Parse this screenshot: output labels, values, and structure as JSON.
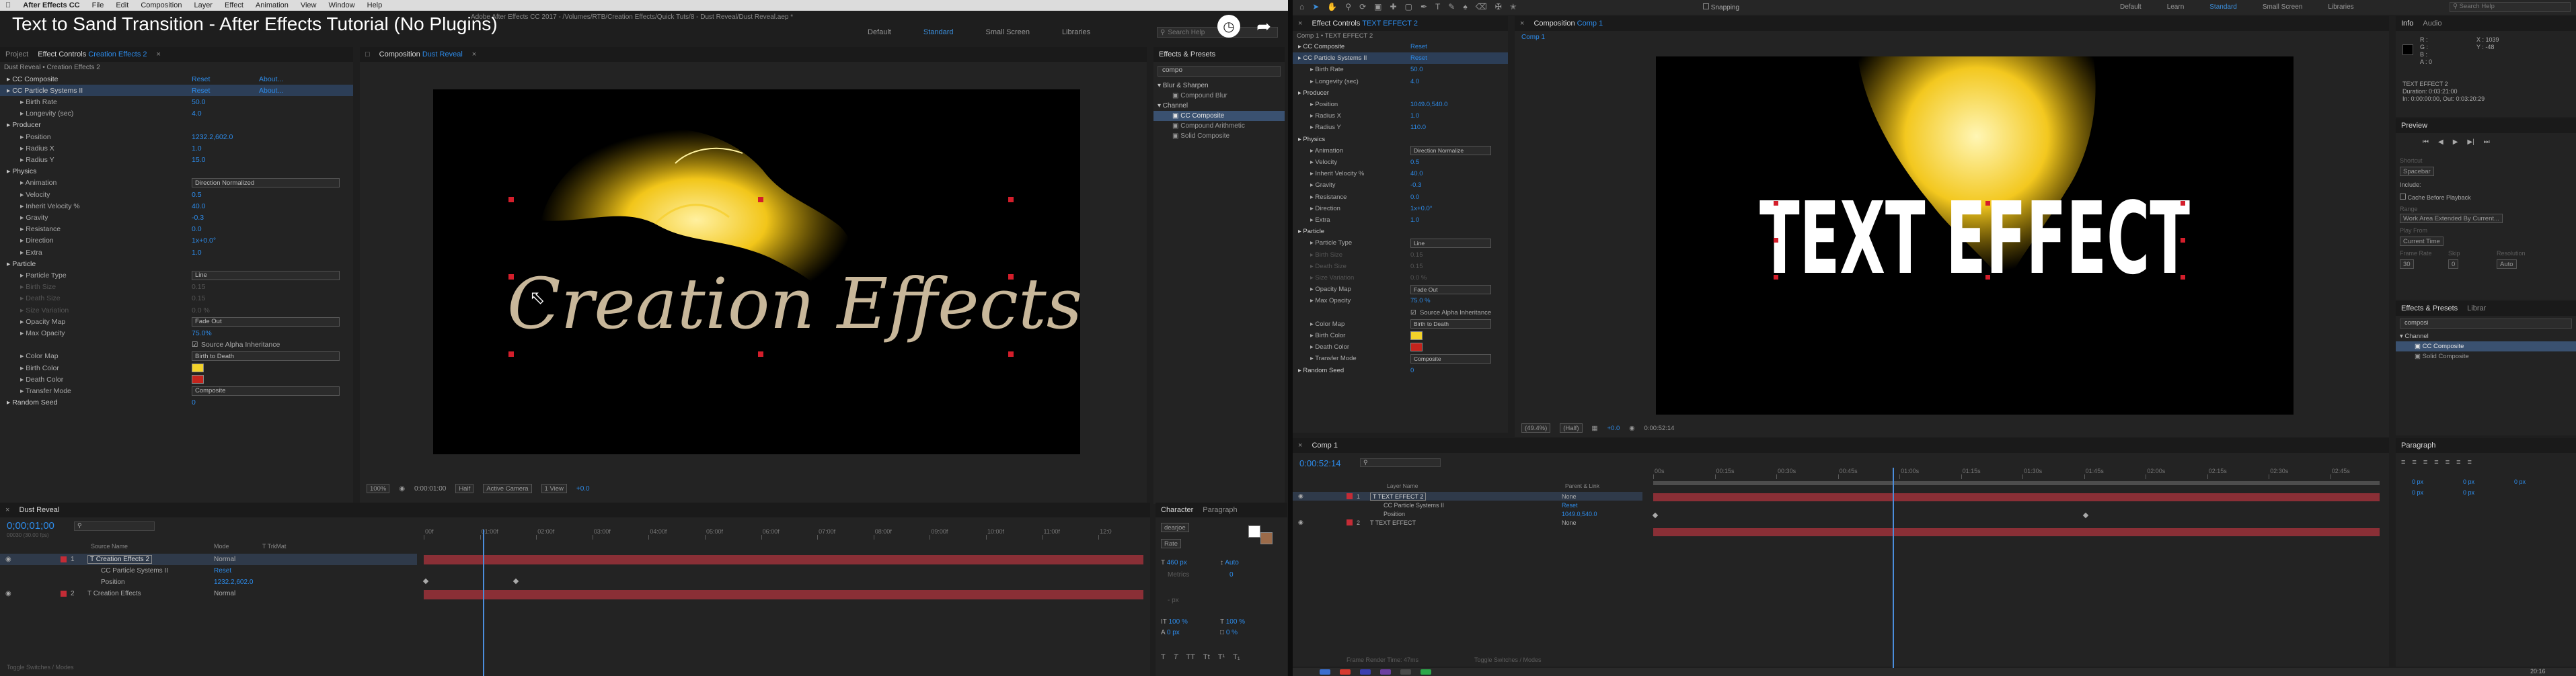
{
  "video": {
    "title": "Text to Sand Transition - After Effects Tutorial (No Plugins)"
  },
  "left_app": {
    "app_name": "After Effects CC",
    "menu": [
      "File",
      "Edit",
      "Composition",
      "Layer",
      "Effect",
      "Animation",
      "View",
      "Window",
      "Help"
    ],
    "title_path": "Adobe After Effects CC 2017 - /Volumes/RTB/Creation Effects/Quick Tuts/8 - Dust Reveal/Dust Reveal.aep *",
    "workspaces": [
      "Default",
      "Standard",
      "Small Screen",
      "Libraries"
    ],
    "search_placeholder": "Search Help",
    "project_tab": "Project",
    "effect_controls_tab": "Effect Controls",
    "effect_controls_layer": "Creation Effects 2",
    "breadcrumb": "Dust Reveal • Creation Effects 2",
    "effects": [
      {
        "name": "CC Composite",
        "value": "Reset",
        "extra": "About..."
      },
      {
        "name": "CC Particle Systems II",
        "value": "Reset",
        "extra": "About..."
      },
      {
        "name": "Birth Rate",
        "value": "50.0"
      },
      {
        "name": "Longevity (sec)",
        "value": "4.0"
      },
      {
        "name": "Producer",
        "value": ""
      },
      {
        "name": "Position",
        "value": "1232.2,602.0"
      },
      {
        "name": "Radius X",
        "value": "1.0"
      },
      {
        "name": "Radius Y",
        "value": "15.0"
      },
      {
        "name": "Physics",
        "value": ""
      },
      {
        "name": "Animation",
        "value": "Direction Normalized"
      },
      {
        "name": "Velocity",
        "value": "0.5"
      },
      {
        "name": "Inherit Velocity %",
        "value": "40.0"
      },
      {
        "name": "Gravity",
        "value": "-0.3"
      },
      {
        "name": "Resistance",
        "value": "0.0"
      },
      {
        "name": "Direction",
        "value": "1x+0.0°"
      },
      {
        "name": "Extra",
        "value": "1.0"
      },
      {
        "name": "Particle",
        "value": ""
      },
      {
        "name": "Particle Type",
        "value": "Line"
      },
      {
        "name": "Birth Size",
        "value": "0.15"
      },
      {
        "name": "Death Size",
        "value": "0.15"
      },
      {
        "name": "Size Variation",
        "value": "0.0 %"
      },
      {
        "name": "Opacity Map",
        "value": "Fade Out"
      },
      {
        "name": "Max Opacity",
        "value": "75.0%"
      },
      {
        "name": "Source Alpha Inheritance",
        "value": ""
      },
      {
        "name": "Color Map",
        "value": "Birth to Death"
      },
      {
        "name": "Birth Color",
        "value": ""
      },
      {
        "name": "Death Color",
        "value": ""
      },
      {
        "name": "Transfer Mode",
        "value": "Composite"
      },
      {
        "name": "Random Seed",
        "value": "0"
      }
    ],
    "comp_tab": "Composition",
    "comp_name": "Dust Reveal",
    "comp_text": "Creation Effects",
    "viewer_bar": {
      "zoom": "100%",
      "timecode": "0:00:01:00",
      "resolution": "Half",
      "camera": "Active Camera",
      "views": "1 View",
      "exposure": "+0.0"
    },
    "effects_presets": {
      "title": "Effects & Presets",
      "search": "compo",
      "items": [
        "Blur & Sharpen",
        "Compound Blur",
        "Channel",
        "CC Composite",
        "Compound Arithmetic",
        "Solid Composite"
      ]
    },
    "timeline": {
      "tab": "Dust Reveal",
      "timecode": "0;00;01;00",
      "fps_label": "00030 (30.00 fps)",
      "col_headers": [
        "Source Name",
        "Mode",
        "T TrkMat"
      ],
      "layers": [
        {
          "num": "1",
          "name": "Creation Effects 2",
          "mode": "Normal"
        },
        {
          "num": "",
          "name": "CC Particle Systems II",
          "mode": "Reset"
        },
        {
          "num": "",
          "name": "Position",
          "mode": "1232.2,602.0"
        },
        {
          "num": "2",
          "name": "Creation Effects",
          "mode": "Normal"
        }
      ],
      "ruler": [
        "00f",
        "01:00f",
        "02:00f",
        "03:00f",
        "04:00f",
        "05:00f",
        "06:00f",
        "07:00f",
        "08:00f",
        "09:00f",
        "10:00f",
        "11:00f",
        "12:0"
      ],
      "bottom_label": "Toggle Switches / Modes"
    },
    "character": {
      "tab1": "Character",
      "tab2": "Paragraph",
      "font": "dearjoe",
      "style": "Rate",
      "size": "460 px",
      "leading": "Auto",
      "kerning": "Metrics",
      "tracking": "0",
      "stroke": "- px",
      "scale_v": "100 %",
      "scale_h": "100 %",
      "baseline": "0 px",
      "tsume": "0 %"
    }
  },
  "right_app": {
    "menu_workspaces": [
      "Default",
      "Learn",
      "Standard",
      "Small Screen",
      "Libraries"
    ],
    "snapping": "Snapping",
    "search_placeholder": "Search Help",
    "effect_controls_tab": "Effect Controls",
    "effect_controls_layer": "TEXT EFFECT 2",
    "breadcrumb": "Comp 1 • TEXT EFFECT 2",
    "effects": [
      {
        "name": "CC Composite",
        "value": "Reset"
      },
      {
        "name": "CC Particle Systems II",
        "value": "Reset"
      },
      {
        "name": "Birth Rate",
        "value": "50.0"
      },
      {
        "name": "Longevity (sec)",
        "value": "4.0"
      },
      {
        "name": "Producer",
        "value": ""
      },
      {
        "name": "Position",
        "value": "1049.0,540.0"
      },
      {
        "name": "Radius X",
        "value": "1.0"
      },
      {
        "name": "Radius Y",
        "value": "110.0"
      },
      {
        "name": "Physics",
        "value": ""
      },
      {
        "name": "Animation",
        "value": "Direction Normalize"
      },
      {
        "name": "Velocity",
        "value": "0.5"
      },
      {
        "name": "Inherit Velocity %",
        "value": "40.0"
      },
      {
        "name": "Gravity",
        "value": "-0.3"
      },
      {
        "name": "Resistance",
        "value": "0.0"
      },
      {
        "name": "Direction",
        "value": "1x+0.0°"
      },
      {
        "name": "Extra",
        "value": "1.0"
      },
      {
        "name": "Particle",
        "value": ""
      },
      {
        "name": "Particle Type",
        "value": "Line"
      },
      {
        "name": "Birth Size",
        "value": "0.15"
      },
      {
        "name": "Death Size",
        "value": "0.15"
      },
      {
        "name": "Size Variation",
        "value": "0.0 %"
      },
      {
        "name": "Opacity Map",
        "value": "Fade Out"
      },
      {
        "name": "Max Opacity",
        "value": "75.0 %"
      },
      {
        "name": "Source Alpha Inheritance",
        "value": ""
      },
      {
        "name": "Color Map",
        "value": "Birth to Death"
      },
      {
        "name": "Birth Color",
        "value": ""
      },
      {
        "name": "Death Color",
        "value": ""
      },
      {
        "name": "Transfer Mode",
        "value": "Composite"
      },
      {
        "name": "Random Seed",
        "value": "0"
      }
    ],
    "comp_tab": "Composition",
    "comp_name": "Comp 1",
    "comp_text": "TEXT EFFECT",
    "viewer_bar": {
      "zoom": "(49.4%)",
      "resolution": "(Half)",
      "exposure": "+0.0",
      "timecode": "0:00:52:14"
    },
    "info": {
      "tab1": "Info",
      "tab2": "Audio",
      "lines": [
        "R :",
        "G :",
        "B :",
        "A : 0"
      ],
      "coords": [
        "X : 1039",
        "Y : -48"
      ],
      "detail": [
        "TEXT EFFECT 2",
        "Duration: 0:03:21:00",
        "In: 0:00:00:00, Out: 0:03:20:29"
      ]
    },
    "preview": {
      "title": "Preview",
      "shortcut_label": "Shortcut",
      "shortcut": "Spacebar",
      "include": "Include:",
      "cache": "Cache Before Playback",
      "range_label": "Range",
      "range": "Work Area Extended By Current...",
      "play_from_label": "Play From",
      "play_from": "Current Time",
      "frame_rate_label": "Frame Rate",
      "skip_label": "Skip",
      "resolution_label": "Resolution",
      "frame_rate": "30",
      "skip": "0",
      "resolution": "Auto"
    },
    "effects_presets": {
      "title": "Effects & Presets",
      "tab2": "Librar",
      "search": "composi",
      "items": [
        "Channel",
        "CC Composite",
        "Solid Composite"
      ]
    },
    "paragraph": {
      "title": "Paragraph",
      "values": [
        "0 px",
        "0 px",
        "0 px",
        "0 px",
        "0 px"
      ]
    },
    "timeline": {
      "tab": "Comp 1",
      "timecode": "0:00:52:14",
      "col_headers": [
        "Layer Name",
        "Parent & Link"
      ],
      "layers": [
        {
          "num": "1",
          "name": "TEXT EFFECT 2",
          "parent": "None"
        },
        {
          "num": "",
          "name": "CC Particle Systems II",
          "parent": "Reset"
        },
        {
          "num": "",
          "name": "Position",
          "parent": "1049.0,540.0"
        },
        {
          "num": "2",
          "name": "TEXT EFFECT",
          "parent": "None"
        }
      ],
      "ruler": [
        "00s",
        "00:15s",
        "00:30s",
        "00:45s",
        "01:00s",
        "01:15s",
        "01:30s",
        "01:45s",
        "02:00s",
        "02:15s",
        "02:30s",
        "02:45s"
      ],
      "frame_render": "Frame Render Time: 47ms",
      "bottom_label": "Toggle Switches / Modes"
    },
    "clock": "20:16"
  }
}
